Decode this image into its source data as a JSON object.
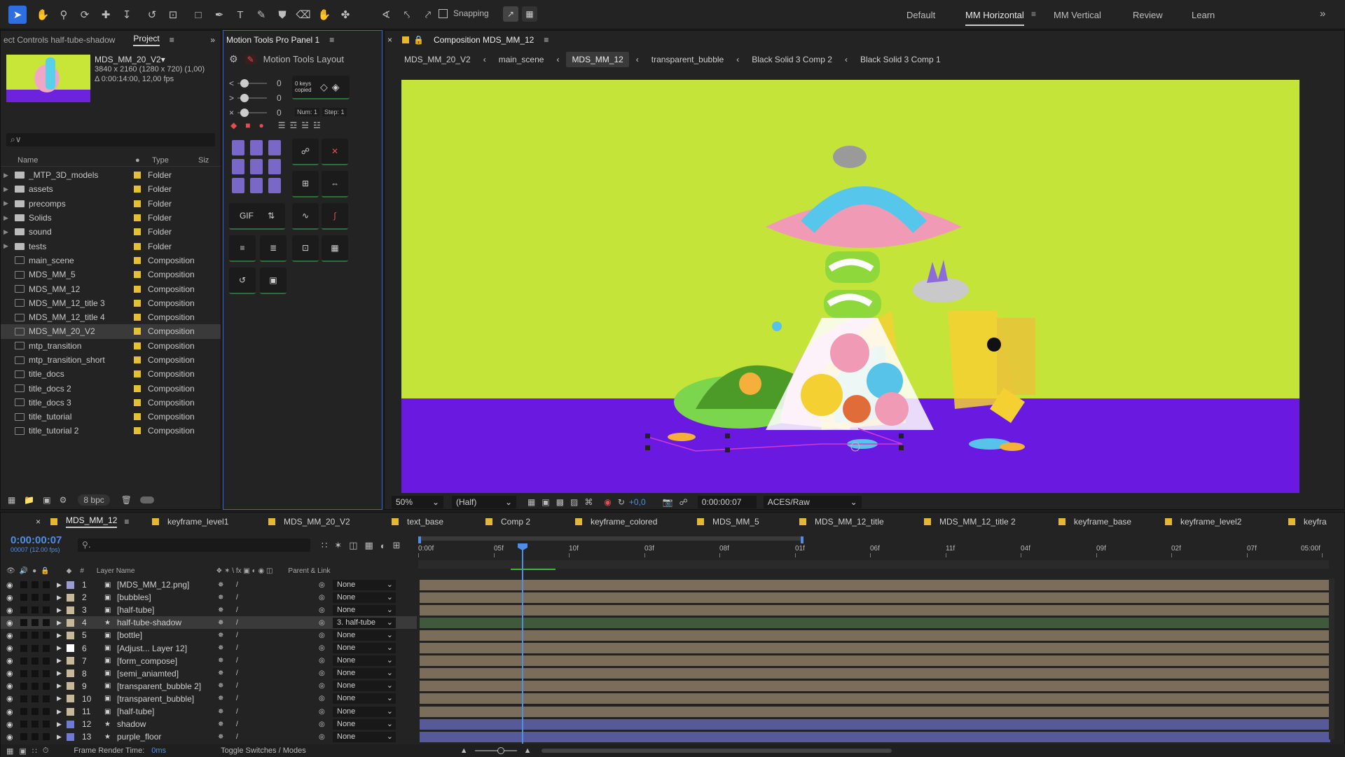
{
  "toolbar": {
    "snapping": "Snapping",
    "workspaces": [
      "Default",
      "MM Horizontal",
      "MM Vertical",
      "Review",
      "Learn"
    ],
    "tools": [
      "selection-tool-icon",
      "hand-tool-icon",
      "zoom-tool-icon",
      "orbit-camera-icon",
      "pan-camera-icon",
      "dolly-camera-icon",
      "rotate-tool-icon",
      "anchor-tool-icon",
      "rectangle-tool-icon",
      "pen-tool-icon",
      "type-tool-icon",
      "brush-tool-icon",
      "clone-stamp-icon",
      "eraser-icon",
      "roto-brush-icon",
      "puppet-pin-icon"
    ]
  },
  "project_panel": {
    "effect_controls_tab": "ect Controls half-tube-shadow",
    "project_tab": "Project",
    "preview_name": "MDS_MM_20_V2▾",
    "preview_dims": "3840 x 2160 (1280 x 720) (1,00)",
    "preview_duration": "Δ 0:00:14:00, 12,00 fps",
    "search_placeholder": "⌕∨",
    "col_name": "Name",
    "col_type": "Type",
    "col_size": "Siz",
    "bpc": "8 bpc",
    "items": [
      {
        "name": "_MTP_3D_models",
        "type": "Folder",
        "folder": true
      },
      {
        "name": "assets",
        "type": "Folder",
        "folder": true
      },
      {
        "name": "precomps",
        "type": "Folder",
        "folder": true
      },
      {
        "name": "Solids",
        "type": "Folder",
        "folder": true
      },
      {
        "name": "sound",
        "type": "Folder",
        "folder": true
      },
      {
        "name": "tests",
        "type": "Folder",
        "folder": true
      },
      {
        "name": "main_scene",
        "type": "Composition"
      },
      {
        "name": "MDS_MM_5",
        "type": "Composition"
      },
      {
        "name": "MDS_MM_12",
        "type": "Composition"
      },
      {
        "name": "MDS_MM_12_title 3",
        "type": "Composition"
      },
      {
        "name": "MDS_MM_12_title 4",
        "type": "Composition"
      },
      {
        "name": "MDS_MM_20_V2",
        "type": "Composition",
        "selected": true
      },
      {
        "name": "mtp_transition",
        "type": "Composition"
      },
      {
        "name": "mtp_transition_short",
        "type": "Composition"
      },
      {
        "name": "title_docs",
        "type": "Composition"
      },
      {
        "name": "title_docs 2",
        "type": "Composition"
      },
      {
        "name": "title_docs 3",
        "type": "Composition"
      },
      {
        "name": "title_tutorial",
        "type": "Composition"
      },
      {
        "name": "title_tutorial 2",
        "type": "Composition"
      }
    ]
  },
  "motion_tools": {
    "tab": "Motion Tools Pro Panel 1",
    "layout": "Motion Tools Layout",
    "keys_info": "0 keys copied",
    "num": "Num: 1",
    "step": "Step: 1",
    "gif": "GIF",
    "slider_values": [
      "0",
      "0",
      "0"
    ]
  },
  "composition": {
    "tab": "Composition MDS_MM_12",
    "breadcrumbs": [
      "MDS_MM_20_V2",
      "main_scene",
      "MDS_MM_12",
      "transparent_bubble",
      "Black Solid 3 Comp 2",
      "Black Solid 3 Comp 1"
    ],
    "active_crumb": "MDS_MM_12",
    "zoom": "50%",
    "resolution": "(Half)",
    "exposure": "+0,0",
    "timecode": "0:00:00:07",
    "color_mgmt": "ACES/Raw",
    "colors": {
      "bg": "#c5e43a",
      "floor": "#6a1ae0"
    }
  },
  "timeline": {
    "tabs": [
      "MDS_MM_12",
      "keyframe_level1",
      "MDS_MM_20_V2",
      "text_base",
      "Comp 2",
      "keyframe_colored",
      "MDS_MM_5",
      "MDS_MM_12_title",
      "MDS_MM_12_title 2",
      "keyframe_base",
      "keyframe_level2",
      "keyfra"
    ],
    "timecode": "0:00:00:07",
    "frame_info": "00007 (12.00 fps)",
    "col_layer": "Layer Name",
    "col_parent": "Parent & Link",
    "col_num": "#",
    "ruler": [
      "0:00f",
      "05f",
      "10f",
      "03f",
      "08f",
      "01f",
      "06f",
      "11f",
      "04f",
      "09f",
      "02f",
      "07f",
      "05:00f"
    ],
    "render_time_label": "Frame Render Time:",
    "render_time": "0ms",
    "toggle": "Toggle Switches / Modes",
    "layers": [
      {
        "num": "1",
        "name": "[MDS_MM_12.png]",
        "parent": "None",
        "color": "#9b9bd4",
        "bar": "tan"
      },
      {
        "num": "2",
        "name": "[bubbles]",
        "parent": "None",
        "color": "#c8b89a",
        "bar": "tan"
      },
      {
        "num": "3",
        "name": "[half-tube]",
        "parent": "None",
        "color": "#c8b89a",
        "bar": "tan"
      },
      {
        "num": "4",
        "name": "half-tube-shadow",
        "parent": "3. half-tube",
        "color": "#c8b89a",
        "bar": "green",
        "selected": true
      },
      {
        "num": "5",
        "name": "[bottle]",
        "parent": "None",
        "color": "#c8b89a",
        "bar": "tan"
      },
      {
        "num": "6",
        "name": "[Adjust... Layer 12]",
        "parent": "None",
        "color": "#ffffff",
        "bar": "tan"
      },
      {
        "num": "7",
        "name": "[form_compose]",
        "parent": "None",
        "color": "#c8b89a",
        "bar": "tan"
      },
      {
        "num": "8",
        "name": "[semi_aniamted]",
        "parent": "None",
        "color": "#c8b89a",
        "bar": "tan"
      },
      {
        "num": "9",
        "name": "[transparent_bubble 2]",
        "parent": "None",
        "color": "#c8b89a",
        "bar": "tan"
      },
      {
        "num": "10",
        "name": "[transparent_bubble]",
        "parent": "None",
        "color": "#c8b89a",
        "bar": "tan"
      },
      {
        "num": "11",
        "name": "[half-tube]",
        "parent": "None",
        "color": "#c8b89a",
        "bar": "tan"
      },
      {
        "num": "12",
        "name": "shadow",
        "parent": "None",
        "color": "#6f7ad6",
        "bar": "blue"
      },
      {
        "num": "13",
        "name": "purple_floor",
        "parent": "None",
        "color": "#6f7ad6",
        "bar": "blue"
      }
    ]
  }
}
